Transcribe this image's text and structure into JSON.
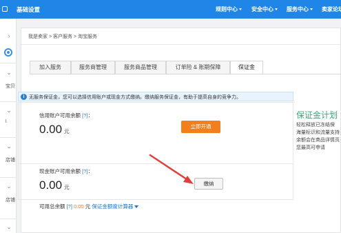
{
  "topbar": {
    "brand": "基础设置",
    "nav": [
      "规则中心",
      "安全中心",
      "服务中心",
      "卖家论坛"
    ]
  },
  "sidebar": {
    "texts": [
      "宝贝",
      "l",
      "店铺",
      "店铺"
    ]
  },
  "breadcrumb": "我是卖家 > 客户服务 > 淘宝服务",
  "tabs": [
    "加入服务",
    "服务商管理",
    "服务商品管理",
    "订单险 & 账期保障",
    "保证金"
  ],
  "notice": {
    "icon": "i",
    "text": "无服务保证金，您可以选择信用账户或现金方式缴纳。缴纳服务保证金，有助于提高自身的竞争力。"
  },
  "credit": {
    "label": "信用账户可用余额",
    "help": "[?]",
    "amount": "0.00",
    "unit": "元",
    "button": "立即开通"
  },
  "cash": {
    "label": "现金账户可用余额",
    "help": "[?]",
    "amount": "0.00",
    "unit": "元",
    "button": "缴纳"
  },
  "summary": {
    "prefix": "可用总余额",
    "help": "[?]",
    "value": "0.00",
    "unit": "元",
    "link": "保证金额度计算器"
  },
  "plan": {
    "title": "保证金计划",
    "lines": [
      "轻松释放已冻结保",
      "海量标识和流量支持",
      "余额会在商品详情页",
      "您最高可申请"
    ]
  },
  "colors": {
    "topbar": "#1f86e8",
    "orange_button": "#f27e1c",
    "arrow": "#e0403a",
    "plan_green": "#3aa876"
  }
}
